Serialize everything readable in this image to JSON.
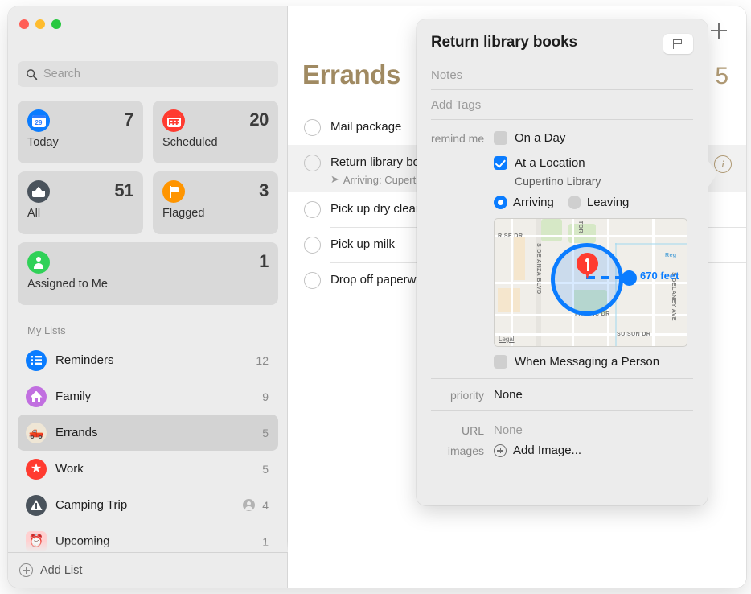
{
  "window": {
    "traffic_lights": [
      "close",
      "minimize",
      "zoom"
    ]
  },
  "sidebar": {
    "search": {
      "placeholder": "Search",
      "icon": "search-icon"
    },
    "smart_lists": [
      {
        "label": "Today",
        "count": "7",
        "icon": "calendar-icon",
        "icon_color": "#0a7cff",
        "day": "29"
      },
      {
        "label": "Scheduled",
        "count": "20",
        "icon": "calendar-grid-icon",
        "icon_color": "#ff3b30"
      },
      {
        "label": "All",
        "count": "51",
        "icon": "tray-icon",
        "icon_color": "#4a535c"
      },
      {
        "label": "Flagged",
        "count": "3",
        "icon": "flag-icon",
        "icon_color": "#ff9500"
      },
      {
        "label": "Assigned to Me",
        "count": "1",
        "icon": "person-icon",
        "icon_color": "#30d158"
      }
    ],
    "my_lists_header": "My Lists",
    "lists": [
      {
        "label": "Reminders",
        "count": "12",
        "icon": "list-lines-icon",
        "icon_color": "#0a7cff",
        "selected": false,
        "shared": false
      },
      {
        "label": "Family",
        "count": "9",
        "icon": "house-icon",
        "icon_color": "#c16fe0",
        "selected": false,
        "shared": false
      },
      {
        "label": "Errands",
        "count": "5",
        "icon": "pickup-truck-emoji",
        "icon_color": "#efe6d5",
        "emoji": "🛻",
        "selected": true,
        "shared": false
      },
      {
        "label": "Work",
        "count": "5",
        "icon": "star-icon",
        "icon_color": "#ff3b30",
        "selected": false,
        "shared": false
      },
      {
        "label": "Camping Trip",
        "count": "4",
        "icon": "triangle-warning-icon",
        "icon_color": "#4a535c",
        "selected": false,
        "shared": true
      },
      {
        "label": "Upcoming",
        "count": "1",
        "icon": "alarm-clock-emoji",
        "icon_color": "#ffd0d0",
        "emoji": "⏰",
        "selected": false,
        "shared": false
      }
    ],
    "add_list": {
      "label": "Add List",
      "icon": "plus-circle-icon"
    }
  },
  "main": {
    "title": "Errands",
    "count": "5",
    "add_button": "add-reminder-icon",
    "info_button": "i",
    "tasks": [
      {
        "title": "Mail package",
        "subtitle": ""
      },
      {
        "title": "Return library books",
        "subtitle": "Arriving: Cupertino Library",
        "subtitle_icon": "location-arrow-icon",
        "selected": true
      },
      {
        "title": "Pick up dry cleaning",
        "subtitle": ""
      },
      {
        "title": "Pick up milk",
        "subtitle": ""
      },
      {
        "title": "Drop off paperwork",
        "subtitle": ""
      }
    ]
  },
  "popover": {
    "title": "Return library books",
    "flag_button": "flag-outline-icon",
    "notes_placeholder": "Notes",
    "tags_placeholder": "Add Tags",
    "remind_me_label": "remind me",
    "on_a_day": {
      "label": "On a Day",
      "checked": false
    },
    "at_a_location": {
      "label": "At a Location",
      "checked": true,
      "value": "Cupertino Library"
    },
    "arriving": {
      "label": "Arriving",
      "selected": true
    },
    "leaving": {
      "label": "Leaving",
      "selected": false
    },
    "map": {
      "distance_label": "670 feet",
      "legal_label": "Legal",
      "street_labels": [
        "RISE DR",
        "S DE ANZA BLVD",
        "TOR",
        "PACIFIC DR",
        "SUISUN DR",
        "S DELANEY AVE",
        "Reg"
      ],
      "pin_color": "#ff3b30",
      "radius_color": "#0a7cff"
    },
    "when_messaging": {
      "label": "When Messaging a Person",
      "checked": false
    },
    "priority": {
      "label": "priority",
      "value": "None"
    },
    "url": {
      "label": "URL",
      "value": "None"
    },
    "images": {
      "label": "images",
      "value": "Add Image...",
      "icon": "plus-circle-icon"
    }
  }
}
